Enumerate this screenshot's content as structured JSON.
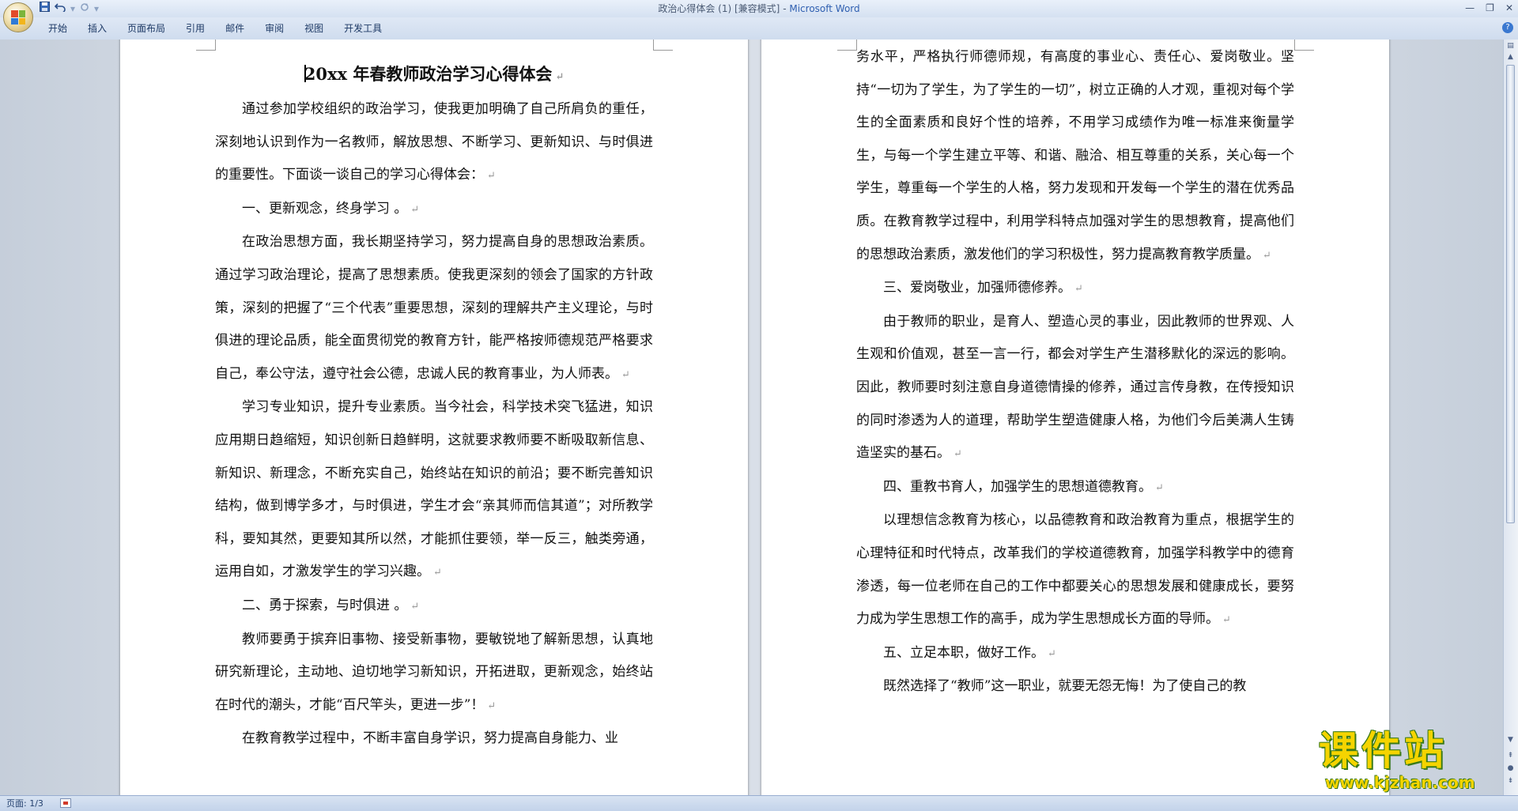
{
  "window": {
    "title": "政治心得体会 (1) [兼容模式]",
    "app_name": "Microsoft Word",
    "title_separator": "-"
  },
  "quick_access": {
    "save_icon": "save-icon",
    "undo_icon": "undo-icon",
    "redo_icon": "redo-icon",
    "customize_icon": "dropdown-icon"
  },
  "ribbon": {
    "tabs": [
      "开始",
      "插入",
      "页面布局",
      "引用",
      "邮件",
      "审阅",
      "视图",
      "开发工具"
    ]
  },
  "document": {
    "title": "20xx 年春教师政治学习心得体会",
    "left_page": [
      {
        "text": "通过参加学校组织的政治学习，使我更加明确了自己所肩负的重任，深刻地认识到作为一名教师，解放思想、不断学习、更新知识、与时俱进的重要性。下面谈一谈自己的学习心得体会：",
        "mark": "↵"
      },
      {
        "text": "一、更新观念，终身学习 。",
        "mark": "↵"
      },
      {
        "text": "在政治思想方面，我长期坚持学习，努力提高自身的思想政治素质。通过学习政治理论，提高了思想素质。使我更深刻的领会了国家的方针政策，深刻的把握了“三个代表”重要思想，深刻的理解共产主义理论，与时俱进的理论品质，能全面贯彻党的教育方针，能严格按师德规范严格要求自己，奉公守法，遵守社会公德，忠诚人民的教育事业，为人师表。",
        "mark": "↵"
      },
      {
        "text": "学习专业知识，提升专业素质。当今社会，科学技术突飞猛进，知识应用期日趋缩短，知识创新日趋鲜明，这就要求教师要不断吸取新信息、新知识、新理念，不断充实自己，始终站在知识的前沿；要不断完善知识结构，做到博学多才，与时俱进，学生才会“亲其师而信其道”；对所教学科，要知其然，更要知其所以然，才能抓住要领，举一反三，触类旁通，运用自如，才激发学生的学习兴趣。",
        "mark": "↵"
      },
      {
        "text": "二、勇于探索，与时俱进 。",
        "mark": "↵"
      },
      {
        "text": "教师要勇于摈弃旧事物、接受新事物，要敏锐地了解新思想，认真地研究新理论，主动地、迫切地学习新知识，开拓进取，更新观念，始终站在时代的潮头，才能“百尺竿头，更进一步”！",
        "mark": "↵"
      },
      {
        "text": "在教育教学过程中，不断丰富自身学识，努力提高自身能力、业",
        "mark": ""
      }
    ],
    "right_page": [
      {
        "text": "务水平，严格执行师德师规，有高度的事业心、责任心、爱岗敬业。坚持“一切为了学生，为了学生的一切”，树立正确的人才观，重视对每个学生的全面素质和良好个性的培养，不用学习成绩作为唯一标准来衡量学生，与每一个学生建立平等、和谐、融洽、相互尊重的关系，关心每一个学生，尊重每一个学生的人格，努力发现和开发每一个学生的潜在优秀品质。在教育教学过程中，利用学科特点加强对学生的思想教育，提高他们的思想政治素质，激发他们的学习积极性，努力提高教育教学质量。",
        "mark": "↵",
        "noindent": true
      },
      {
        "text": "三、爱岗敬业，加强师德修养。",
        "mark": "↵"
      },
      {
        "text": "由于教师的职业，是育人、塑造心灵的事业，因此教师的世界观、人生观和价值观，甚至一言一行，都会对学生产生潜移默化的深远的影响。因此，教师要时刻注意自身道德情操的修养，通过言传身教，在传授知识的同时渗透为人的道理，帮助学生塑造健康人格，为他们今后美满人生铸造坚实的基石。",
        "mark": "↵"
      },
      {
        "text": "四、重教书育人，加强学生的思想道德教育。",
        "mark": "↵"
      },
      {
        "text": "以理想信念教育为核心，以品德教育和政治教育为重点，根据学生的心理特征和时代特点，改革我们的学校道德教育，加强学科教学中的德育渗透，每一位老师在自己的工作中都要关心的思想发展和健康成长，要努力成为学生思想工作的高手，成为学生思想成长方面的导师。",
        "mark": "↵"
      },
      {
        "text": "五、立足本职，做好工作。",
        "mark": "↵"
      },
      {
        "text": "既然选择了“教师”这一职业，就要无怨无悔！为了使自己的教",
        "mark": ""
      }
    ]
  },
  "statusbar": {
    "page_info": "页面: 1/3"
  },
  "watermark": {
    "name": "课件站",
    "url": "www.kjzhan.com"
  },
  "colors": {
    "app_name": "#2f5fb0",
    "ribbon_text": "#1e3a66",
    "watermark_fill": "#f5d400",
    "watermark_outline": "#3a7a18"
  }
}
